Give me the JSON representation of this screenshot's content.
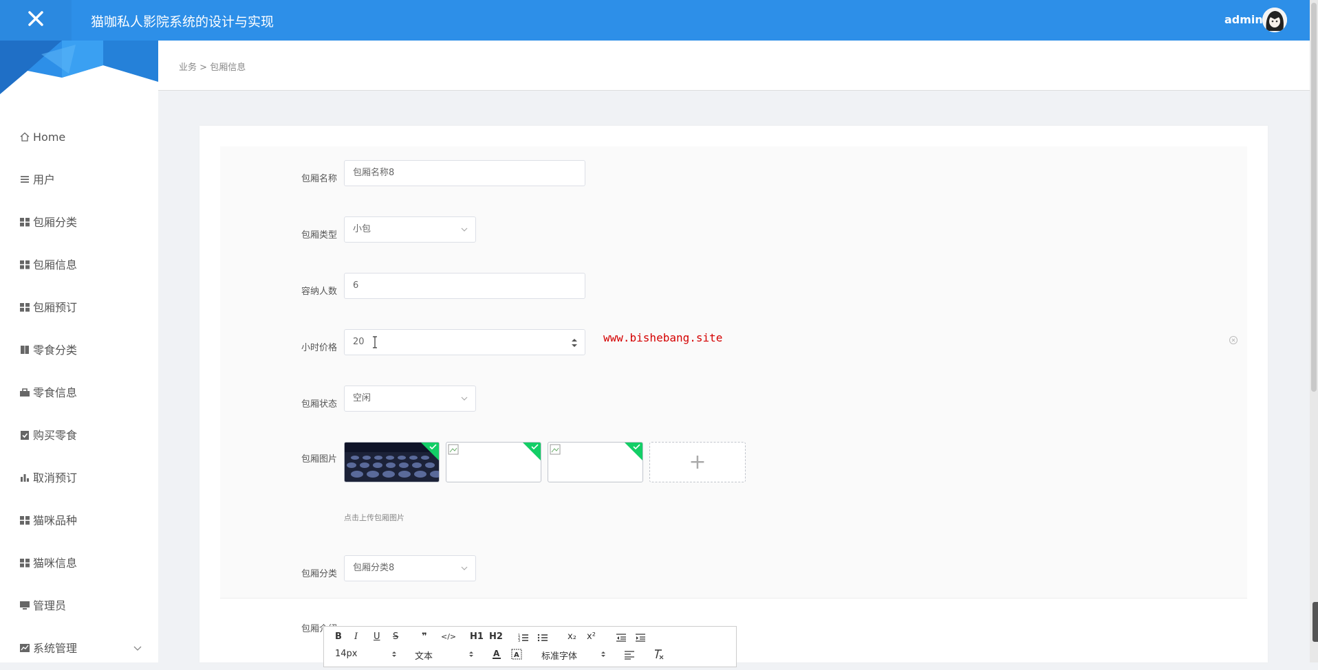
{
  "header": {
    "title": "猫咖私人影院系统的设计与实现",
    "username": "admin",
    "brand_color": "#2d8fe8"
  },
  "sidebar": {
    "items": [
      {
        "label": "Home",
        "icon": "home-icon"
      },
      {
        "label": "用户",
        "icon": "list-icon"
      },
      {
        "label": "包厢分类",
        "icon": "grid-icon"
      },
      {
        "label": "包厢信息",
        "icon": "grid-icon"
      },
      {
        "label": "包厢预订",
        "icon": "grid-icon"
      },
      {
        "label": "零食分类",
        "icon": "book-icon"
      },
      {
        "label": "零食信息",
        "icon": "briefcase-icon"
      },
      {
        "label": "购买零食",
        "icon": "clipboard-check-icon"
      },
      {
        "label": "取消预订",
        "icon": "bar-chart-icon"
      },
      {
        "label": "猫咪品种",
        "icon": "grid-icon"
      },
      {
        "label": "猫咪信息",
        "icon": "grid-icon"
      },
      {
        "label": "管理员",
        "icon": "monitor-icon"
      },
      {
        "label": "系统管理",
        "icon": "line-chart-icon"
      }
    ]
  },
  "breadcrumb": {
    "parent": "业务",
    "separator": ">",
    "current": "包厢信息"
  },
  "form": {
    "name": {
      "label": "包厢名称",
      "value": "包厢名称8"
    },
    "type": {
      "label": "包厢类型",
      "value": "小包"
    },
    "capacity": {
      "label": "容纳人数",
      "value": "6"
    },
    "price": {
      "label": "小时价格",
      "value": "20"
    },
    "status": {
      "label": "包厢状态",
      "value": "空闲"
    },
    "images": {
      "label": "包厢图片",
      "hint": "点击上传包厢图片",
      "upload_symbol": "+"
    },
    "category": {
      "label": "包厢分类",
      "value": "包厢分类8"
    },
    "intro": {
      "label": "包厢介绍"
    }
  },
  "watermark": "www.bishebang.site",
  "editor_toolbar": {
    "row1": [
      "B",
      "I",
      "U",
      "S",
      "❞",
      "</>",
      "H1",
      "H2",
      "ol",
      "ul",
      "x₂",
      "x²",
      "outdent",
      "indent"
    ],
    "font_size": "14px",
    "block_type": "文本",
    "font_family": "标准字体"
  }
}
